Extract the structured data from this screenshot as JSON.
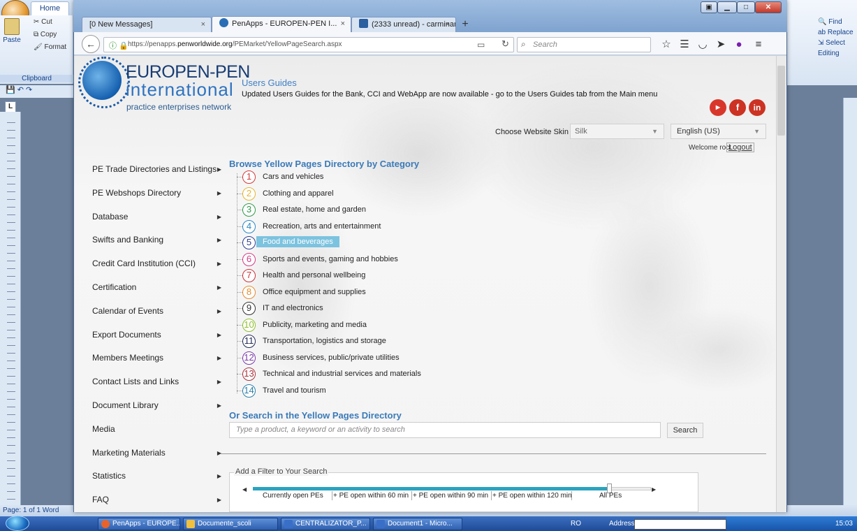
{
  "word": {
    "tab_home": "Home",
    "cut": "Cut",
    "copy": "Copy",
    "format": "Format",
    "paste": "Paste",
    "clipboard": "Clipboard",
    "find": "Find",
    "replace": "Replace",
    "select": "Select",
    "editing": "Editing",
    "status": "Page: 1 of 1",
    "status_app": "Word"
  },
  "browser": {
    "tabs": [
      {
        "label": "[0 New Messages]"
      },
      {
        "label": "PenApps - EUROPEN-PEN I..."
      },
      {
        "label": "(2333 unread) - carminam..."
      }
    ],
    "url_prefix": "https://penapps.",
    "url_domain": "penworldwide.org",
    "url_path": "/PEMarket/YellowPageSearch.aspx",
    "search_placeholder": "Search"
  },
  "header": {
    "logo_title": "EUROPEN-PEN",
    "logo_sub": "international",
    "logo_tag": "practice enterprises network",
    "guides_title": "Users Guides",
    "guides_text": "Updated Users Guides for the Bank, CCI and WebApp are now available - go to the Users Guides tab from the Main menu",
    "skin_label": "Choose Website Skin",
    "skin_value": "Silk",
    "language": "English (US)",
    "welcome": "Welcome roct",
    "logout": "Logout"
  },
  "menu": [
    {
      "label": "PE Trade Directories and Listings",
      "arrow": true
    },
    {
      "label": "PE Webshops Directory",
      "arrow": true
    },
    {
      "label": "Database",
      "arrow": true
    },
    {
      "label": "Swifts and Banking",
      "arrow": true
    },
    {
      "label": "Credit Card Institution (CCI)",
      "arrow": true
    },
    {
      "label": "Certification",
      "arrow": true
    },
    {
      "label": "Calendar of Events",
      "arrow": true
    },
    {
      "label": "Export Documents",
      "arrow": true
    },
    {
      "label": "Members Meetings",
      "arrow": true
    },
    {
      "label": "Contact Lists and Links",
      "arrow": true
    },
    {
      "label": "Document Library",
      "arrow": true
    },
    {
      "label": "Media",
      "arrow": false
    },
    {
      "label": "Marketing Materials",
      "arrow": true
    },
    {
      "label": "Statistics",
      "arrow": true
    },
    {
      "label": "FAQ",
      "arrow": true
    }
  ],
  "browse": {
    "title": "Browse Yellow Pages Directory by Category",
    "categories": [
      {
        "num": "1",
        "label": "Cars and vehicles",
        "color": "#d23a3a"
      },
      {
        "num": "2",
        "label": "Clothing and apparel",
        "color": "#e5b531"
      },
      {
        "num": "3",
        "label": "Real estate, home and garden",
        "color": "#2f9a48"
      },
      {
        "num": "4",
        "label": "Recreation, arts and entertainment",
        "color": "#2a88c4"
      },
      {
        "num": "5",
        "label": "Food and beverages",
        "color": "#2b3d8f"
      },
      {
        "num": "6",
        "label": "Sports and events, gaming and hobbies",
        "color": "#d43a83"
      },
      {
        "num": "7",
        "label": "Health and personal wellbeing",
        "color": "#c8323b"
      },
      {
        "num": "8",
        "label": "Office equipment and supplies",
        "color": "#e58a2d"
      },
      {
        "num": "9",
        "label": "IT and electronics",
        "color": "#333333"
      },
      {
        "num": "10",
        "label": "Publicity, marketing and media",
        "color": "#8fbf2e"
      },
      {
        "num": "11",
        "label": "Transportation, logistics and storage",
        "color": "#222a55"
      },
      {
        "num": "12",
        "label": "Business services, public/private utilities",
        "color": "#7a3aa8"
      },
      {
        "num": "13",
        "label": "Technical and industrial services and materials",
        "color": "#a8323b"
      },
      {
        "num": "14",
        "label": "Travel and tourism",
        "color": "#2c7fa8"
      }
    ],
    "selected_index": 4
  },
  "search": {
    "title": "Or Search in the Yellow Pages Directory",
    "placeholder": "Type a product, a keyword or an activity to search",
    "button": "Search"
  },
  "filter": {
    "title": "Add a Filter to Your Search",
    "ticks": [
      "Currently open PEs",
      "+ PE open within 60 min",
      "+ PE open within 90 min",
      "+ PE open within 120 min",
      "All PEs"
    ]
  },
  "taskbar": {
    "items": [
      "PenApps - EUROPE...",
      "Documente_scoli",
      "CENTRALIZATOR_P...",
      "Document1 - Micro..."
    ],
    "lang": "RO",
    "address": "Address",
    "time": "15:03"
  },
  "colors": {
    "accent": "#3b7ab8",
    "selected_bg": "#7cc3df",
    "slider": "#2ba3bf"
  }
}
